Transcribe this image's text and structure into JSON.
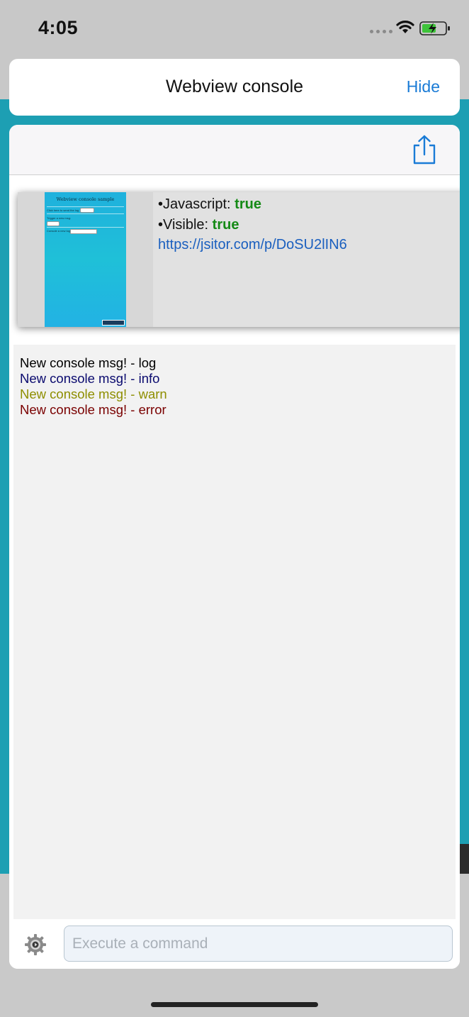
{
  "status_bar": {
    "time": "4:05",
    "icons": [
      "signal-dots-icon",
      "wifi-icon",
      "battery-charging-icon"
    ]
  },
  "header": {
    "title": "Webview console",
    "hide_label": "Hide"
  },
  "toolbar": {
    "share_icon": "share-icon"
  },
  "preview": {
    "thumbnail": {
      "title": "Webview console sample",
      "line1": "Click here to send the log",
      "line2": "Trigger a new msg:",
      "line3": "Console a new log:"
    },
    "javascript_label": "•Javascript: ",
    "javascript_value": "true",
    "visible_label": "•Visible: ",
    "visible_value": "true",
    "url": "https://jsitor.com/p/DoSU2lIN6"
  },
  "console": {
    "messages": [
      {
        "text": "New console msg! - log",
        "level": "log",
        "color": "#000000"
      },
      {
        "text": "New console msg! - info",
        "level": "info",
        "color": "#0a0a6e"
      },
      {
        "text": "New console msg! - warn",
        "level": "warn",
        "color": "#8e8e00"
      },
      {
        "text": "New console msg! - error",
        "level": "error",
        "color": "#7a0000"
      }
    ]
  },
  "command_input": {
    "placeholder": "Execute a command",
    "value": ""
  },
  "colors": {
    "accent": "#1a7bd6",
    "page_background": "#1d9fb3",
    "true_value": "#158a16"
  }
}
